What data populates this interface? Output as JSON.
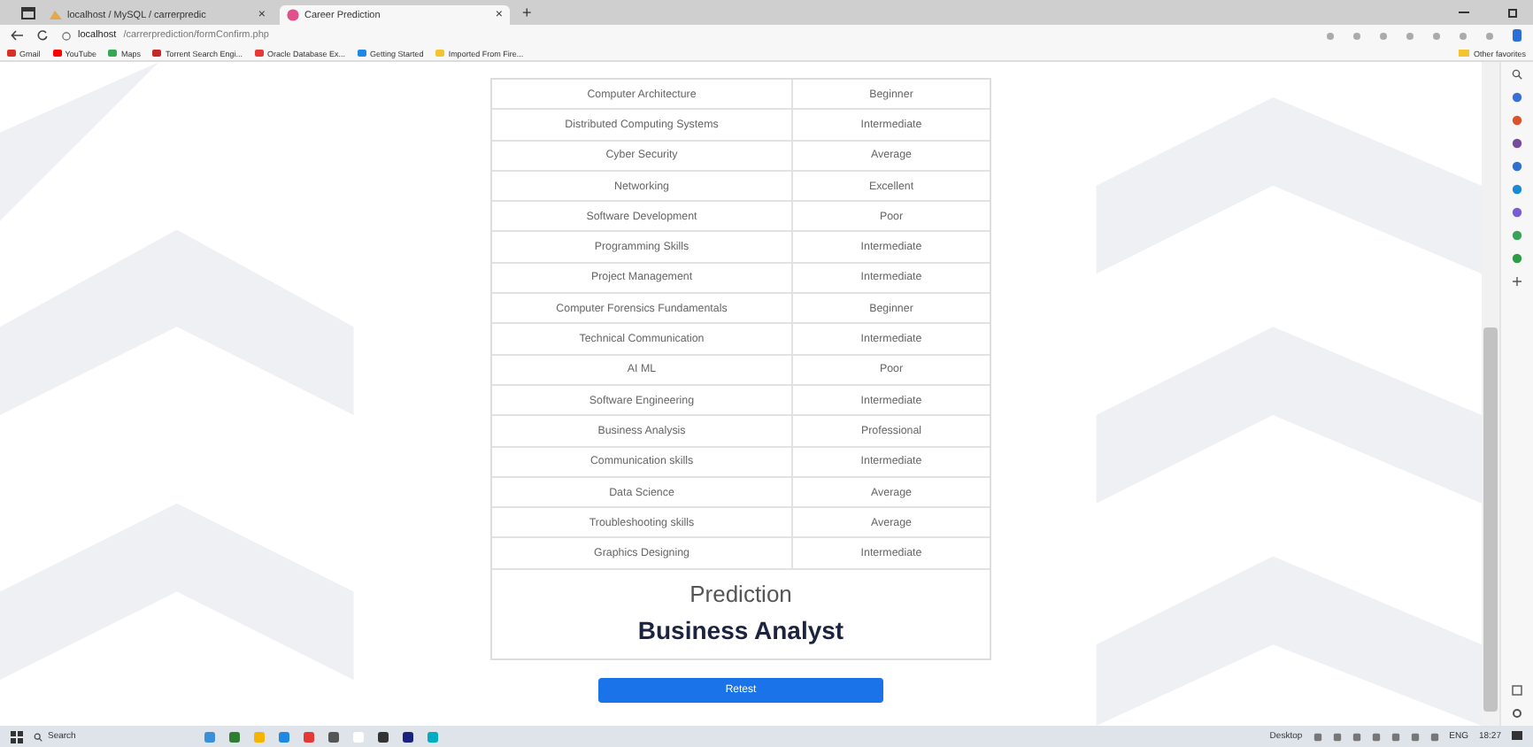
{
  "browser": {
    "tabs": [
      {
        "label": "localhost / MySQL / carrerpredic",
        "close": "×",
        "selected": false
      },
      {
        "label": "Career Prediction",
        "close": "×",
        "selected": true
      }
    ],
    "new_tab": "+",
    "address": {
      "host": "localhost",
      "path": "/carrerprediction/formConfirm.php"
    },
    "bookmarks": [
      {
        "label": "Gmail",
        "color": "#d93025"
      },
      {
        "label": "YouTube",
        "color": "#ff0000"
      },
      {
        "label": "Maps",
        "color": "#34a853"
      },
      {
        "label": "Torrent Search Engi...",
        "color": "#c62828"
      },
      {
        "label": "Oracle Database Ex...",
        "color": "#e53935"
      },
      {
        "label": "Getting Started",
        "color": "#1e88e5"
      },
      {
        "label": "Imported From Fire...",
        "color": "#f4c430"
      }
    ],
    "other_favorites": "Other favorites"
  },
  "table": {
    "rows": [
      {
        "skill": "Computer Architecture",
        "level": "Beginner"
      },
      {
        "skill": "Distributed Computing Systems",
        "level": "Intermediate"
      },
      {
        "skill": "Cyber Security",
        "level": "Average"
      },
      {
        "skill": "Networking",
        "level": "Excellent"
      },
      {
        "skill": "Software Development",
        "level": "Poor"
      },
      {
        "skill": "Programming Skills",
        "level": "Intermediate"
      },
      {
        "skill": "Project Management",
        "level": "Intermediate"
      },
      {
        "skill": "Computer Forensics Fundamentals",
        "level": "Beginner"
      },
      {
        "skill": "Technical Communication",
        "level": "Intermediate"
      },
      {
        "skill": "AI ML",
        "level": "Poor"
      },
      {
        "skill": "Software Engineering",
        "level": "Intermediate"
      },
      {
        "skill": "Business Analysis",
        "level": "Professional"
      },
      {
        "skill": "Communication skills",
        "level": "Intermediate"
      },
      {
        "skill": "Data Science",
        "level": "Average"
      },
      {
        "skill": "Troubleshooting skills",
        "level": "Average"
      },
      {
        "skill": "Graphics Designing",
        "level": "Intermediate"
      }
    ]
  },
  "prediction": {
    "heading": "Prediction",
    "result": "Business Analyst"
  },
  "retest_button": "Retest",
  "taskbar": {
    "search": "Search",
    "desktop": "Desktop",
    "language": "ENG",
    "time": "18:27"
  }
}
